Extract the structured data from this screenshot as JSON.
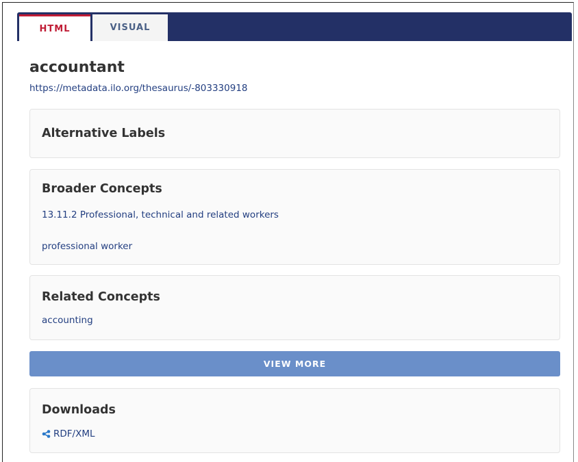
{
  "tabs": [
    {
      "label": "HTML",
      "active": true
    },
    {
      "label": "VISUAL",
      "active": false
    }
  ],
  "concept": {
    "title": "accountant",
    "uri": "https://metadata.ilo.org/thesaurus/-803330918"
  },
  "alternative_labels": {
    "heading": "Alternative Labels"
  },
  "broader_concepts": {
    "heading": "Broader Concepts",
    "items": [
      "13.11.2 Professional, technical and related workers",
      "professional worker"
    ]
  },
  "related_concepts": {
    "heading": "Related Concepts",
    "items": [
      "accounting"
    ]
  },
  "view_more_label": "VIEW MORE",
  "downloads": {
    "heading": "Downloads",
    "items": [
      {
        "label": "RDF/XML",
        "icon": "share-icon"
      }
    ]
  },
  "colors": {
    "tabbar": "#233066",
    "active_tab": "#c01c35",
    "link": "#223e80",
    "button": "#6a8fc9"
  }
}
